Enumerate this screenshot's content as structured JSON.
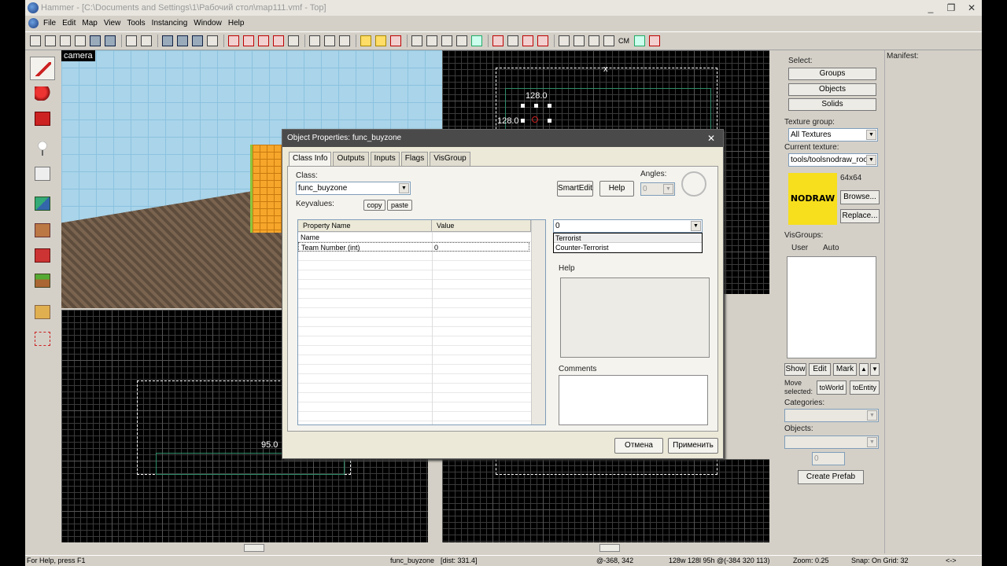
{
  "window": {
    "title": "Hammer - [C:\\Documents and Settings\\1\\Рабочий стол\\map111.vmf - Top]",
    "controls": [
      "_",
      "❐",
      "✕"
    ]
  },
  "menu": [
    "File",
    "Edit",
    "Map",
    "View",
    "Tools",
    "Instancing",
    "Window",
    "Help"
  ],
  "toolbar": {
    "cm_label": "CM"
  },
  "camera": {
    "label": "camera"
  },
  "viewports": {
    "top_right_label_a": "128.0",
    "top_right_label_b": "128.0",
    "bottom_left_label": "95.0",
    "axis_mark": "x"
  },
  "dialog": {
    "title": "Object Properties: func_buyzone",
    "close": "✕",
    "tabs": [
      "Class Info",
      "Outputs",
      "Inputs",
      "Flags",
      "VisGroup"
    ],
    "class_label": "Class:",
    "class_value": "func_buyzone",
    "keyvalues_label": "Keyvalues:",
    "copy_label": "copy",
    "paste_label": "paste",
    "smartedit_label": "SmartEdit",
    "help_button": "Help",
    "angles_label": "Angles:",
    "angles_value": "0",
    "columns": [
      "Property Name",
      "Value"
    ],
    "rows": [
      {
        "name": "Name",
        "value": ""
      },
      {
        "name": "Team Number (int)",
        "value": "0"
      }
    ],
    "value_combo": "0",
    "dropdown_options": [
      "Terrorist",
      "Counter-Terrorist"
    ],
    "help_label": "Help",
    "comments_label": "Comments",
    "cancel_button": "Отмена",
    "apply_button": "Применить"
  },
  "right_panel": {
    "select_label": "Select:",
    "groups_button": "Groups",
    "objects_button": "Objects",
    "solids_button": "Solids",
    "texture_group_label": "Texture group:",
    "texture_group_value": "All Textures",
    "current_texture_label": "Current texture:",
    "current_texture_value": "tools/toolsnodraw_roof",
    "texture_size": "64x64",
    "texture_preview_text": "NODRAW",
    "browse_button": "Browse...",
    "replace_button": "Replace...",
    "visgroups_label": "VisGroups:",
    "visgroup_tabs": [
      "User",
      "Auto"
    ],
    "show_button": "Show",
    "edit_button": "Edit",
    "mark_button": "Mark",
    "up_arrow": "▲",
    "down_arrow": "▼",
    "move_selected_label": "Move\nselected:",
    "to_world_button": "toWorld",
    "to_entity_button": "toEntity",
    "categories_label": "Categories:",
    "objects_label": "Objects:",
    "count_value": "0",
    "create_prefab_button": "Create Prefab",
    "manifest_label": "Manifest:"
  },
  "status": {
    "help": "For Help, press F1",
    "selection": "func_buyzone",
    "dist": "[dist: 331.4]",
    "coords": "@-368, 342",
    "size": "128w 128l 95h @(-384 320 113)",
    "zoom": "Zoom: 0.25",
    "snap": "Snap: On Grid: 32",
    "extra": "<->"
  },
  "colors": {
    "titlebar": "#e8e6df",
    "dialog_title": "#4a4a4a",
    "nodraw": "#f7df1e",
    "grid": "#3a3a3a"
  }
}
